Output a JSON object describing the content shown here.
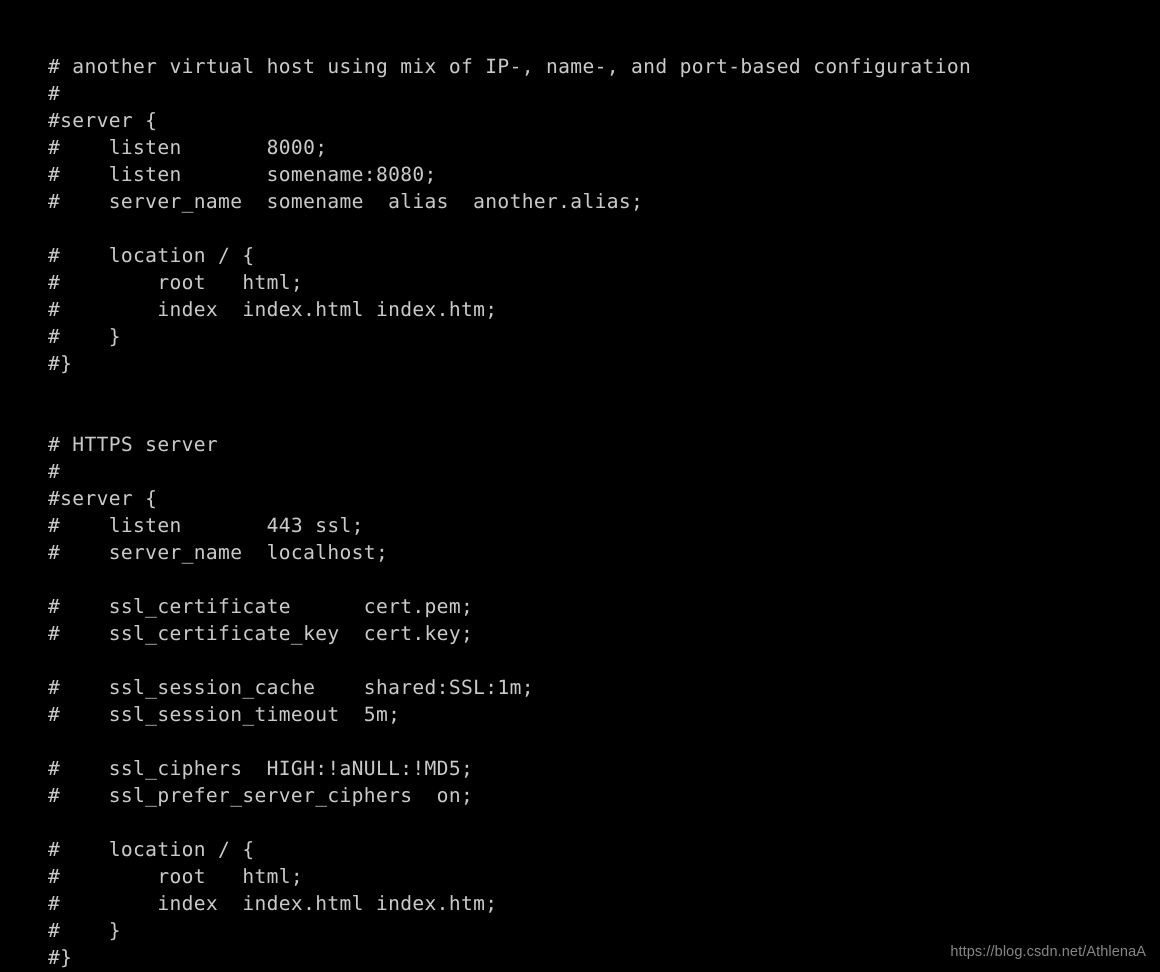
{
  "terminal": {
    "background_color": "#000000",
    "foreground_color": "#c9c9c9",
    "file_kind": "nginx-configuration",
    "lines": [
      "# another virtual host using mix of IP-, name-, and port-based configuration",
      "#",
      "#server {",
      "#    listen       8000;",
      "#    listen       somename:8080;",
      "#    server_name  somename  alias  another.alias;",
      "",
      "#    location / {",
      "#        root   html;",
      "#        index  index.html index.htm;",
      "#    }",
      "#}",
      "",
      "",
      "# HTTPS server",
      "#",
      "#server {",
      "#    listen       443 ssl;",
      "#    server_name  localhost;",
      "",
      "#    ssl_certificate      cert.pem;",
      "#    ssl_certificate_key  cert.key;",
      "",
      "#    ssl_session_cache    shared:SSL:1m;",
      "#    ssl_session_timeout  5m;",
      "",
      "#    ssl_ciphers  HIGH:!aNULL:!MD5;",
      "#    ssl_prefer_server_ciphers  on;",
      "",
      "#    location / {",
      "#        root   html;",
      "#        index  index.html index.htm;",
      "#    }",
      "#}"
    ]
  },
  "watermark": {
    "text": "https://blog.csdn.net/AthlenaA",
    "color": "#8e8e8e"
  }
}
